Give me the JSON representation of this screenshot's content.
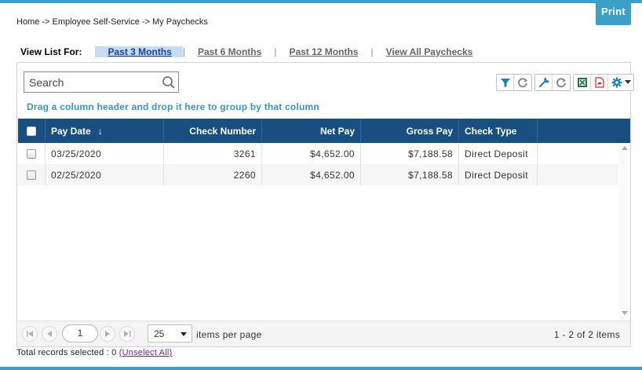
{
  "print_label": "Print",
  "breadcrumb": "Home -> Employee Self-Service -> My Paychecks",
  "view_list": {
    "label": "View List For:",
    "options": [
      "Past 3 Months",
      "Past 6 Months",
      "Past 12 Months",
      "View All Paychecks"
    ],
    "separator": "|",
    "active_index": 0
  },
  "search": {
    "placeholder": "Search",
    "value": ""
  },
  "toolbar_icons": [
    "filter-icon",
    "refresh-icon",
    "wrench-icon",
    "refresh-icon",
    "excel-icon",
    "pdf-icon",
    "gear-icon",
    "caret-down-icon"
  ],
  "group_hint": "Drag a column header and drop it here to group by that column",
  "columns": [
    "Pay Date",
    "Check Number",
    "Net Pay",
    "Gross Pay",
    "Check Type"
  ],
  "sort_indicator": "↓",
  "rows": [
    {
      "pay_date": "03/25/2020",
      "check_number": "3261",
      "net_pay": "$4,652.00",
      "gross_pay": "$7,188.58",
      "check_type": "Direct Deposit"
    },
    {
      "pay_date": "02/25/2020",
      "check_number": "2260",
      "net_pay": "$4,652.00",
      "gross_pay": "$7,188.58",
      "check_type": "Direct Deposit"
    }
  ],
  "pager": {
    "page": "1",
    "page_size": "25",
    "page_size_label": "items per page",
    "info": "1 - 2 of 2 items"
  },
  "footer": {
    "total_text": "Total records selected : 0",
    "unselect_label": "(Unselect All)"
  },
  "colors": {
    "accent": "#3aa0c8",
    "header_bg": "#164f80",
    "hint_text": "#3a94c0",
    "active_tab_bg": "#c8dcf0"
  }
}
